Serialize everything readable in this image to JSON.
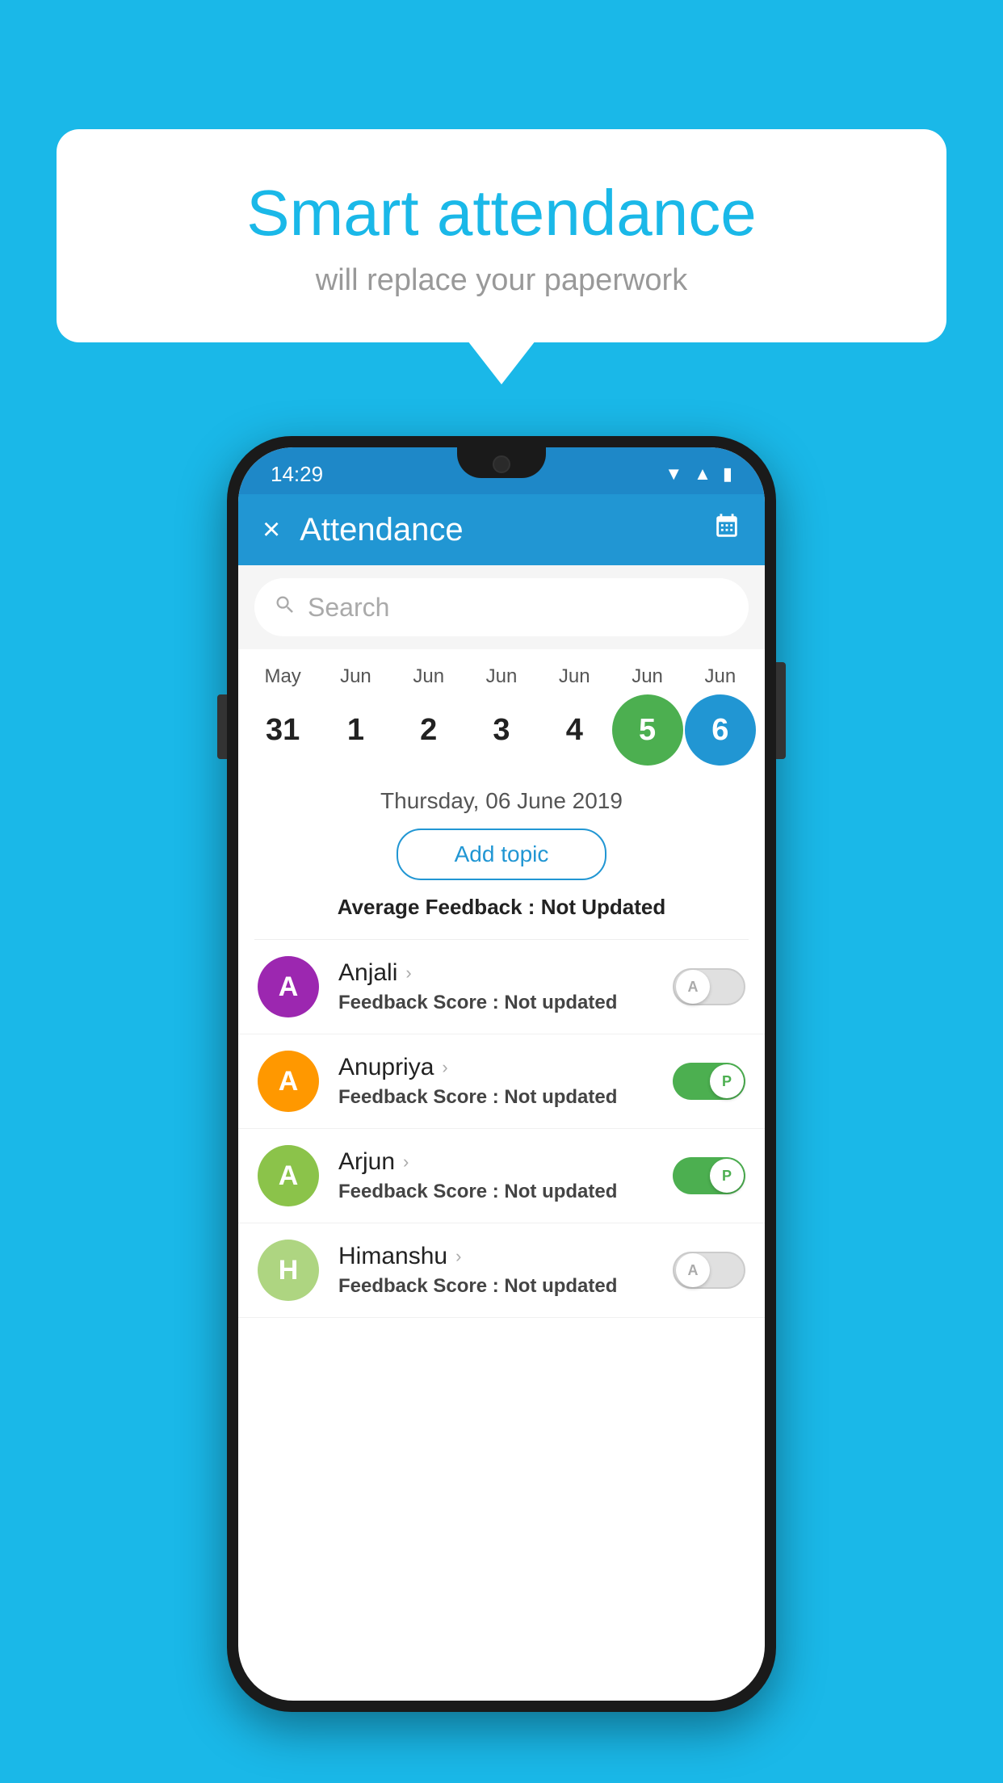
{
  "background_color": "#1ab8e8",
  "bubble": {
    "title": "Smart attendance",
    "subtitle": "will replace your paperwork"
  },
  "phone": {
    "status_bar": {
      "time": "14:29",
      "wifi_icon": "▾",
      "signal_icon": "▲",
      "battery_icon": "▮"
    },
    "header": {
      "close_label": "×",
      "title": "Attendance",
      "calendar_icon": "📅"
    },
    "search": {
      "placeholder": "Search"
    },
    "calendar": {
      "months": [
        "May",
        "Jun",
        "Jun",
        "Jun",
        "Jun",
        "Jun",
        "Jun"
      ],
      "dates": [
        "31",
        "1",
        "2",
        "3",
        "4",
        "5",
        "6"
      ],
      "active_green_index": 4,
      "active_blue_index": 5
    },
    "selected_date": "Thursday, 06 June 2019",
    "add_topic_label": "Add topic",
    "avg_feedback_label": "Average Feedback :",
    "avg_feedback_value": "Not Updated",
    "students": [
      {
        "name": "Anjali",
        "avatar_letter": "A",
        "avatar_class": "avatar-purple",
        "feedback_label": "Feedback Score :",
        "feedback_value": "Not updated",
        "toggle_state": "off",
        "toggle_letter": "A"
      },
      {
        "name": "Anupriya",
        "avatar_letter": "A",
        "avatar_class": "avatar-orange",
        "feedback_label": "Feedback Score :",
        "feedback_value": "Not updated",
        "toggle_state": "on",
        "toggle_letter": "P"
      },
      {
        "name": "Arjun",
        "avatar_letter": "A",
        "avatar_class": "avatar-green",
        "feedback_label": "Feedback Score :",
        "feedback_value": "Not updated",
        "toggle_state": "on",
        "toggle_letter": "P"
      },
      {
        "name": "Himanshu",
        "avatar_letter": "H",
        "avatar_class": "avatar-lightgreen",
        "feedback_label": "Feedback Score :",
        "feedback_value": "Not updated",
        "toggle_state": "off",
        "toggle_letter": "A"
      }
    ]
  }
}
